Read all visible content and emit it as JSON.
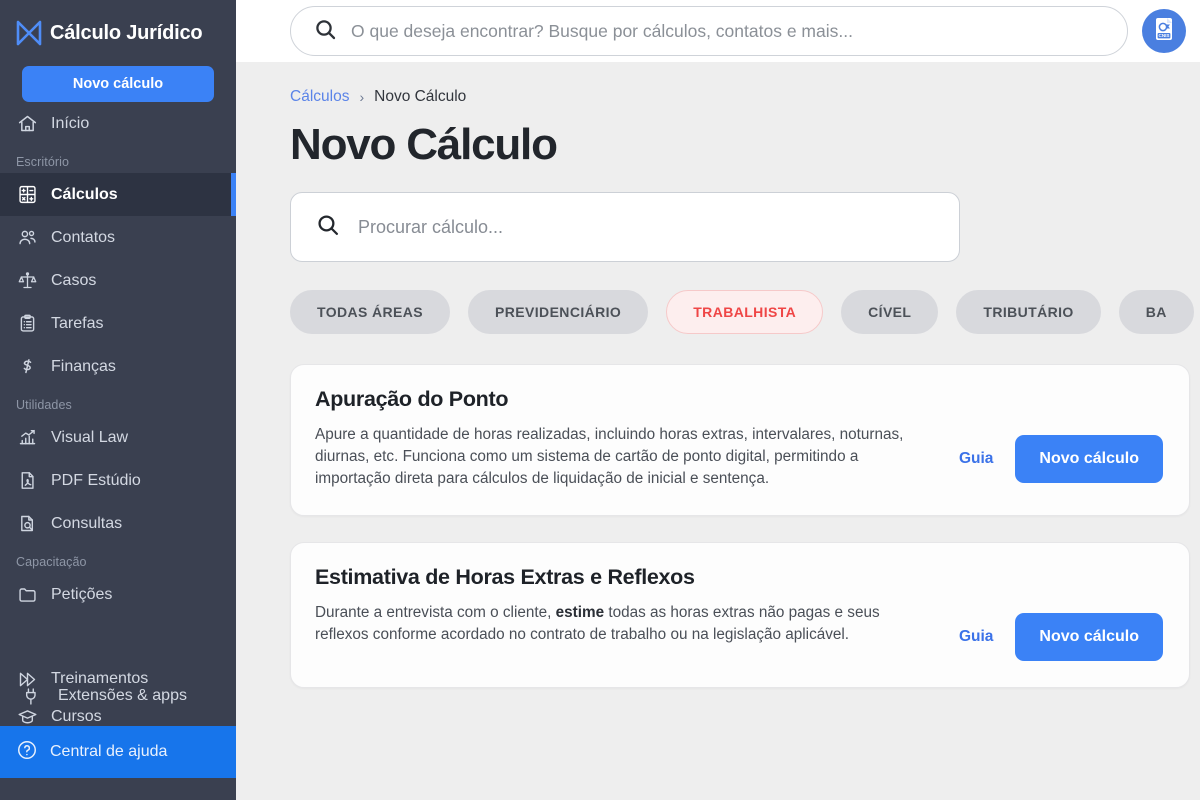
{
  "brand": {
    "name": "Cálculo Jurídico",
    "logo_icon": "m-monogram-logo",
    "accent_blue": "#3b82f6",
    "sidebar_bg": "#3a4050",
    "page_bg": "#eeeeee",
    "selected_chip_color": "#ef4646"
  },
  "sidebar": {
    "new_calc_label": "Novo cálculo",
    "top_items": [
      {
        "label": "Início",
        "icon": "home-icon",
        "active": false
      }
    ],
    "sections": [
      {
        "label": "Escritório",
        "items": [
          {
            "label": "Cálculos",
            "icon": "calculator-icon",
            "active": true
          },
          {
            "label": "Contatos",
            "icon": "people-icon",
            "active": false
          },
          {
            "label": "Casos",
            "icon": "scales-icon",
            "active": false
          },
          {
            "label": "Tarefas",
            "icon": "clipboard-icon",
            "active": false
          },
          {
            "label": "Finanças",
            "icon": "dollar-icon",
            "active": false
          }
        ]
      },
      {
        "label": "Utilidades",
        "items": [
          {
            "label": "Visual Law",
            "icon": "bar-chart-icon",
            "active": false
          },
          {
            "label": "PDF Estúdio",
            "icon": "pdf-file-icon",
            "active": false
          },
          {
            "label": "Consultas",
            "icon": "file-search-icon",
            "active": false
          }
        ]
      },
      {
        "label": "Capacitação",
        "items": [
          {
            "label": "Petições",
            "icon": "folder-icon",
            "active": false
          }
        ]
      }
    ],
    "overflow_items": [
      {
        "label": "Treinamentos",
        "icon": "play-forward-icon"
      },
      {
        "label": "Extensões & apps",
        "icon": "plug-icon"
      },
      {
        "label": "Cursos",
        "icon": "graduation-cap-icon"
      }
    ],
    "help_label": "Central de ajuda",
    "help_icon": "question-circle-icon"
  },
  "topbar": {
    "search_placeholder": "O que deseja encontrar? Busque por cálculos, contatos e mais...",
    "search_value": "",
    "search_icon": "search-icon",
    "cnis_badge_label": "CNIS",
    "cnis_icon": "cnis-file-icon"
  },
  "breadcrumb": {
    "root": "Cálculos",
    "separator": "›",
    "current": "Novo Cálculo"
  },
  "page": {
    "title": "Novo Cálculo"
  },
  "calc_search": {
    "placeholder": "Procurar cálculo...",
    "value": "",
    "icon": "search-icon"
  },
  "filters": {
    "chips": [
      {
        "label": "TODAS ÁREAS",
        "selected": false
      },
      {
        "label": "PREVIDENCIÁRIO",
        "selected": false
      },
      {
        "label": "TRABALHISTA",
        "selected": true
      },
      {
        "label": "CÍVEL",
        "selected": false
      },
      {
        "label": "TRIBUTÁRIO",
        "selected": false
      },
      {
        "label": "BA",
        "selected": false
      }
    ]
  },
  "cards": [
    {
      "title": "Apuração do Ponto",
      "desc_pre": "Apure a quantidade de horas realizadas, incluindo horas extras, intervalares, noturnas, diurnas, etc. Funciona como um sistema de cartão de ponto digital, permitindo a importação direta para cálculos de liquidação de inicial e sentença.",
      "desc_bold": "",
      "desc_post": "",
      "guide_label": "Guia",
      "action_label": "Novo cálculo"
    },
    {
      "title": "Estimativa de Horas Extras e Reflexos",
      "desc_pre": "Durante a entrevista com o cliente, ",
      "desc_bold": "estime",
      "desc_post": " todas as horas extras não pagas e seus reflexos conforme acordado no contrato de trabalho ou na legislação aplicável.",
      "guide_label": "Guia",
      "action_label": "Novo cálculo"
    }
  ]
}
